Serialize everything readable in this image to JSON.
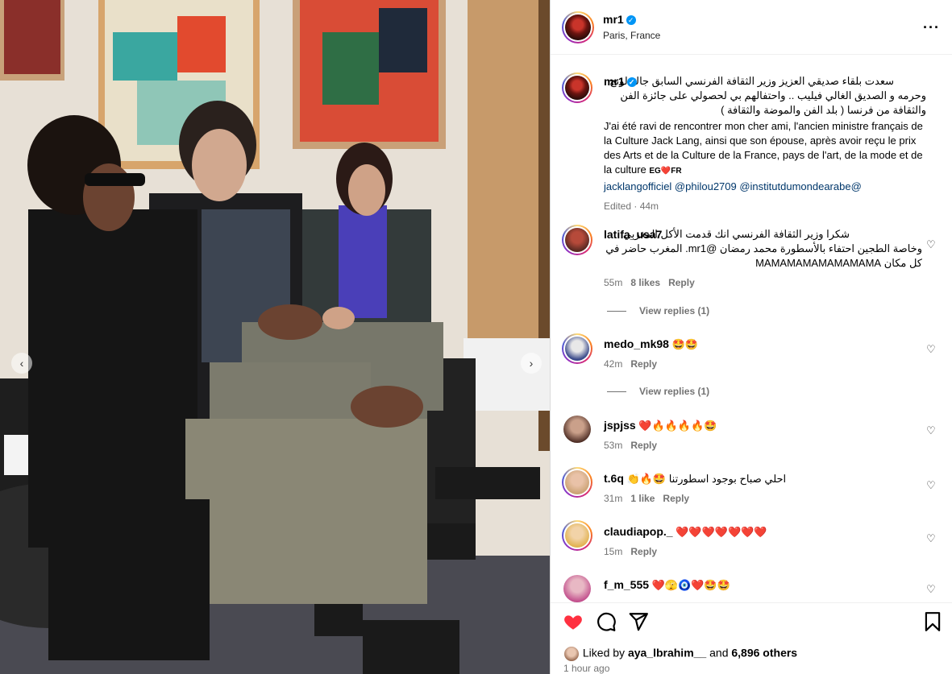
{
  "post": {
    "username": "mr1",
    "location": "Paris, France",
    "caption_ar": "سعدت بلقاء صديقي العزيز وزير الثقافة الفرنسي السابق جاك لونج وحرمه و الصديق الغالي فيليب .. واحتفالهم بي لحصولي على جائزة الفن والثقافة من فرنسا ( بلد الفن والموضة والثقافة )",
    "caption_fr": "J'ai été ravi de rencontrer mon cher ami, l'ancien ministre français de la Culture Jack Lang, ainsi que son épouse, après avoir reçu le prix des Arts et de la Culture de la France, pays de l'art, de la mode et de la culture",
    "caption_flags": "EG❤️FR",
    "mentions": "jacklangofficiel @philou2709 @institutdumondearabe@",
    "edited": "Edited · 44m"
  },
  "comments": [
    {
      "username": "latifa_usa7",
      "text": "شكرا وزير الثقافة الفرنسي انك قدمت الأكل المغربي وخاصة الطجين احتفاء بالأسطورة محمد رمضان @mr1. المغرب حاضر في كل مكان MAMAMAMAMAMAMAMA",
      "time": "55m",
      "likes": "8 likes",
      "reply": "Reply",
      "view_replies": "View replies (1)"
    },
    {
      "username": "medo_mk98",
      "text": "🤩🤩",
      "time": "42m",
      "reply": "Reply",
      "view_replies": "View replies (1)"
    },
    {
      "username": "jspjss",
      "text": "❤️🔥🔥🔥🔥🤩",
      "time": "53m",
      "reply": "Reply"
    },
    {
      "username": "t.6q",
      "text": "👏🔥🤩 احلي صباح بوجود اسطورتنا",
      "time": "31m",
      "likes": "1 like",
      "reply": "Reply"
    },
    {
      "username": "claudiapop._",
      "text": "❤️❤️❤️❤️❤️❤️❤️",
      "time": "15m",
      "reply": "Reply"
    },
    {
      "username": "f_m_555",
      "text": "❤️🫣🧿❤️🤩🤩"
    }
  ],
  "footer": {
    "liked_prefix": "Liked by",
    "liked_user": "aya_lbrahim__",
    "liked_mid": "and",
    "liked_count": "6,896 others",
    "time": "1 hour ago"
  },
  "colors": {
    "like_red": "#ff3040",
    "verified_blue": "#0095f6",
    "link": "#00376b",
    "muted": "#737373"
  }
}
